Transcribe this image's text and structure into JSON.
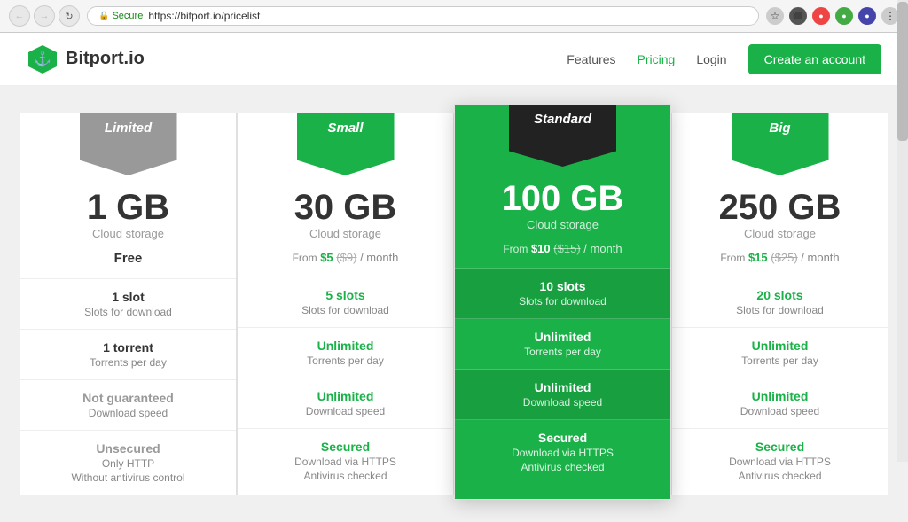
{
  "browser": {
    "secure_label": "Secure",
    "url": "https://bitport.io/pricelist",
    "back_btn": "←",
    "forward_btn": "→",
    "refresh_btn": "↻"
  },
  "navbar": {
    "logo_text": "Bitport.io",
    "logo_icon": "⚓",
    "links": [
      {
        "label": "Features",
        "active": false
      },
      {
        "label": "Pricing",
        "active": true
      },
      {
        "label": "Login",
        "active": false
      }
    ],
    "cta_label": "Create an account"
  },
  "plans": [
    {
      "id": "limited",
      "badge_label": "Limited",
      "badge_class": "badge-gray",
      "storage": "1 GB",
      "storage_label": "Cloud storage",
      "price_display": "free",
      "price_free": "Free",
      "highlighted": false,
      "features": [
        {
          "main": "1 slot",
          "main_class": "",
          "sub": "Slots for download"
        },
        {
          "main": "1 torrent",
          "main_class": "",
          "sub": "Torrents per day"
        },
        {
          "main": "Not guaranteed",
          "main_class": "gray",
          "sub": "Download speed"
        },
        {
          "main": "Unsecured",
          "main_class": "gray",
          "sub_lines": [
            "Only HTTP",
            "Without antivirus control"
          ]
        }
      ]
    },
    {
      "id": "small",
      "badge_label": "Small",
      "badge_class": "badge-green",
      "storage": "30 GB",
      "storage_label": "Cloud storage",
      "price_from": "From",
      "price_amount": "$5",
      "price_old": "$9",
      "price_period": "/ month",
      "highlighted": false,
      "features": [
        {
          "main": "5 slots",
          "main_class": "green",
          "sub": "Slots for download"
        },
        {
          "main": "Unlimited",
          "main_class": "green",
          "sub": "Torrents per day"
        },
        {
          "main": "Unlimited",
          "main_class": "green",
          "sub": "Download speed"
        },
        {
          "main": "Secured",
          "main_class": "green",
          "sub_lines": [
            "Download via HTTPS",
            "Antivirus checked"
          ]
        }
      ]
    },
    {
      "id": "standard",
      "badge_label": "Standard",
      "badge_class": "badge-black",
      "storage": "100 GB",
      "storage_label": "Cloud storage",
      "price_from": "From",
      "price_amount": "$10",
      "price_old": "$15",
      "price_period": "/ month",
      "highlighted": true,
      "features": [
        {
          "main": "10 slots",
          "main_class": "",
          "sub": "Slots for download"
        },
        {
          "main": "Unlimited",
          "main_class": "",
          "sub": "Torrents per day"
        },
        {
          "main": "Unlimited",
          "main_class": "",
          "sub": "Download speed"
        },
        {
          "main": "Secured",
          "main_class": "",
          "sub_lines": [
            "Download via HTTPS",
            "Antivirus checked"
          ]
        }
      ]
    },
    {
      "id": "big",
      "badge_label": "Big",
      "badge_class": "badge-green",
      "storage": "250 GB",
      "storage_label": "Cloud storage",
      "price_from": "From",
      "price_amount": "$15",
      "price_old": "$25",
      "price_period": "/ month",
      "highlighted": false,
      "features": [
        {
          "main": "20 slots",
          "main_class": "green",
          "sub": "Slots for download"
        },
        {
          "main": "Unlimited",
          "main_class": "green",
          "sub": "Torrents per day"
        },
        {
          "main": "Unlimited",
          "main_class": "green",
          "sub": "Download speed"
        },
        {
          "main": "Secured",
          "main_class": "green",
          "sub_lines": [
            "Download via HTTPS",
            "Antivirus checked"
          ]
        }
      ]
    }
  ]
}
